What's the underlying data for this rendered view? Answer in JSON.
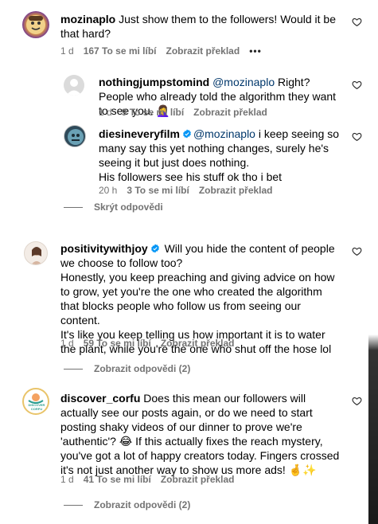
{
  "comments": [
    {
      "user": "mozinaplo",
      "text": "Just show them to the followers! Would it be that hard?",
      "time": "1 d",
      "likes": "167 To se mi líbí",
      "translate": "Zobrazit překlad",
      "more": "•••"
    },
    {
      "user": "nothingjumpstomind",
      "mention": "@mozinaplo",
      "text": " Right? People who already told the algorithm they want to see you. 🤦‍♀️",
      "time": "1 d",
      "likes": "9 To se mi líbí",
      "translate": "Zobrazit překlad"
    },
    {
      "user": "diesineveryfilm",
      "mention": "@mozinaplo",
      "text": " i keep seeing so many say this yet nothing changes, surely he's seeing it but just does nothing.",
      "text2": "His followers see his stuff ok tho i bet",
      "time": "20 h",
      "likes": "3 To se mi líbí",
      "translate": "Zobrazit překlad"
    },
    {
      "user": "positivitywithjoy",
      "text": " Will you hide the content of people we choose to follow too?",
      "text2": "Honestly, you keep preaching and giving advice on how to grow, yet you're the one who created the algorithm that blocks people who follow us from seeing our content.",
      "text3": "It's like you keep telling us how important it is to water the plant, while you're the one who shut off the hose lol",
      "time": "1 d",
      "likes": "59 To se mi líbí",
      "translate": "Zobrazit překlad"
    },
    {
      "user": "discover_corfu",
      "text": " Does this mean our followers will actually see our posts again, or do we need to start posting shaky videos of our dinner to prove we're 'authentic'? 😂 If this actually fixes the reach mystery, you've got a lot of happy creators today. Fingers crossed it's not just another way to show us more ads! 🤞✨",
      "time": "1 d",
      "likes": "41 To se mi líbí",
      "translate": "Zobrazit překlad"
    }
  ],
  "threads": {
    "hide_replies": "Skrýt odpovědi",
    "view_replies_1": "Zobrazit odpovědi (2)",
    "view_replies_2": "Zobrazit odpovědi (2)"
  },
  "avatar_text": {
    "discover_corfu_top": "DISCOVER",
    "discover_corfu_bottom": "CORFU"
  },
  "colors": {
    "muted": "#737373",
    "mention": "#00376b",
    "verified": "#0095f6"
  }
}
